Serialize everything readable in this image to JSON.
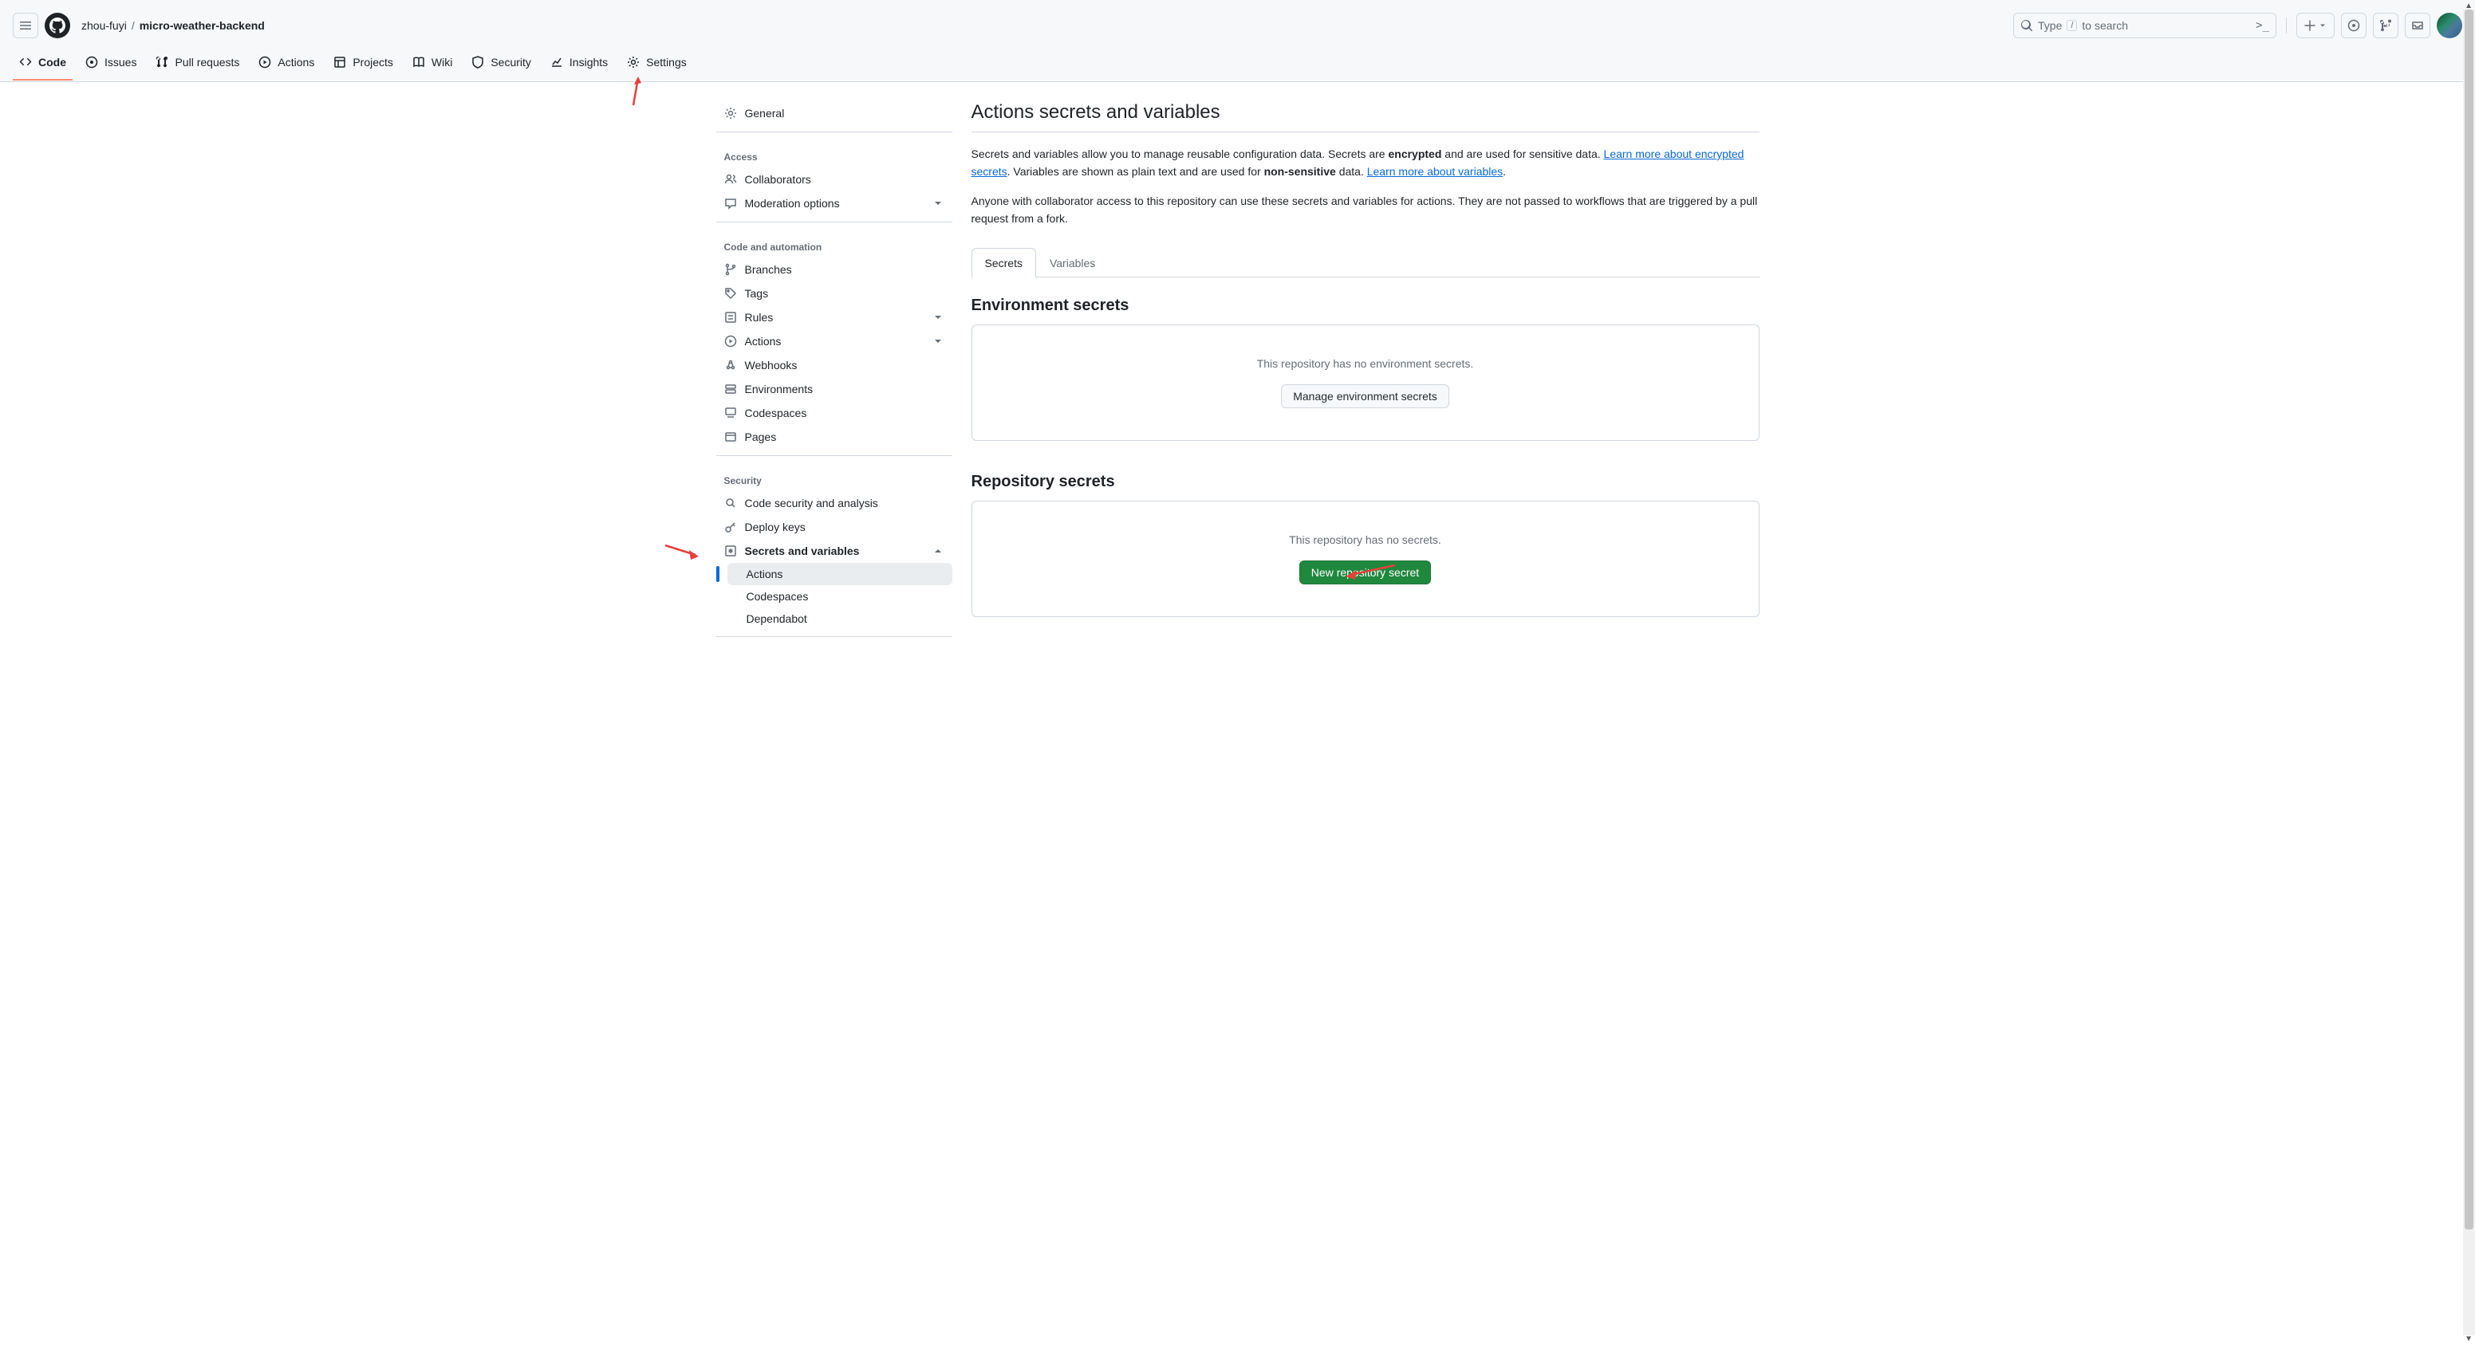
{
  "header": {
    "owner": "zhou-fuyi",
    "repo": "micro-weather-backend",
    "search_placeholder_pre": "Type",
    "search_key": "/",
    "search_placeholder_post": "to search",
    "cmd_prompt": ">_"
  },
  "topnav": [
    {
      "label": "Code",
      "icon": "code"
    },
    {
      "label": "Issues",
      "icon": "issue"
    },
    {
      "label": "Pull requests",
      "icon": "pr"
    },
    {
      "label": "Actions",
      "icon": "play"
    },
    {
      "label": "Projects",
      "icon": "table"
    },
    {
      "label": "Wiki",
      "icon": "book"
    },
    {
      "label": "Security",
      "icon": "shield"
    },
    {
      "label": "Insights",
      "icon": "graph"
    },
    {
      "label": "Settings",
      "icon": "gear"
    }
  ],
  "sidebar": {
    "general": "General",
    "access_heading": "Access",
    "collaborators": "Collaborators",
    "moderation": "Moderation options",
    "code_heading": "Code and automation",
    "branches": "Branches",
    "tags": "Tags",
    "rules": "Rules",
    "actions": "Actions",
    "webhooks": "Webhooks",
    "environments": "Environments",
    "codespaces": "Codespaces",
    "pages": "Pages",
    "security_heading": "Security",
    "code_security": "Code security and analysis",
    "deploy_keys": "Deploy keys",
    "secrets_vars": "Secrets and variables",
    "sub_actions": "Actions",
    "sub_codespaces": "Codespaces",
    "sub_dependabot": "Dependabot"
  },
  "content": {
    "title": "Actions secrets and variables",
    "desc_1a": "Secrets and variables allow you to manage reusable configuration data. Secrets are ",
    "desc_1b_strong": "encrypted",
    "desc_1c": " and are used for sensitive data. ",
    "link_enc": "Learn more about encrypted secrets",
    "desc_1d": ". Variables are shown as plain text and are used for ",
    "desc_1e_strong": "non-sensitive",
    "desc_1f": " data. ",
    "link_var": "Learn more about variables",
    "desc_1g": ".",
    "desc_2": "Anyone with collaborator access to this repository can use these secrets and variables for actions. They are not passed to workflows that are triggered by a pull request from a fork.",
    "tab_secrets": "Secrets",
    "tab_variables": "Variables",
    "env_title": "Environment secrets",
    "env_empty": "This repository has no environment secrets.",
    "env_btn": "Manage environment secrets",
    "repo_title": "Repository secrets",
    "repo_empty": "This repository has no secrets.",
    "repo_btn": "New repository secret"
  }
}
